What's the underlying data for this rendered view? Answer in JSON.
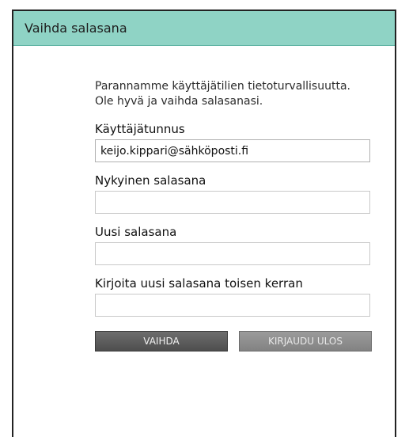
{
  "dialog": {
    "title": "Vaihda salasana",
    "intro": "Parannamme käyttäjätilien tietoturvallisuutta. Ole hyvä ja vaihda salasanasi."
  },
  "form": {
    "username": {
      "label": "Käyttäjätunnus",
      "value": "keijo.kippari@sähköposti.fi"
    },
    "current_password": {
      "label": "Nykyinen salasana",
      "value": ""
    },
    "new_password": {
      "label": "Uusi salasana",
      "value": ""
    },
    "confirm_password": {
      "label": "Kirjoita uusi salasana toisen kerran",
      "value": ""
    }
  },
  "buttons": {
    "change_label": "VAIHDA",
    "logout_label": "KIRJAUDU ULOS"
  },
  "colors": {
    "header_background": "#8fd3c5",
    "primary_button": "#5c5c5c",
    "secondary_button": "#8e8e8e"
  }
}
